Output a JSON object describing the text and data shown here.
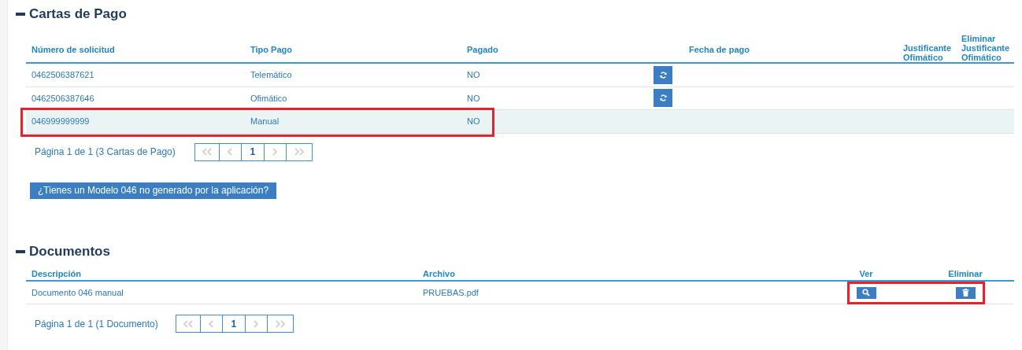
{
  "sections": [
    {
      "kind": "cartas",
      "title": "Cartas de Pago",
      "columns": [
        "Número de solicitud",
        "Tipo Pago",
        "Pagado",
        "",
        "Fecha de pago",
        "Justificante Ofimático",
        "Eliminar Justificante Ofimático"
      ],
      "rows": [
        {
          "cells": [
            "0462506387621",
            "Telemático",
            "NO"
          ],
          "actions": [
            {
              "kind": "refresh"
            }
          ],
          "highlighted": false,
          "outlined": false
        },
        {
          "cells": [
            "0462506387646",
            "Ofimático",
            "NO"
          ],
          "actions": [
            {
              "kind": "refresh"
            }
          ],
          "highlighted": false,
          "outlined": false
        },
        {
          "cells": [
            "046999999999",
            "Manual",
            "NO"
          ],
          "actions": [],
          "highlighted": true,
          "outlined": true
        }
      ],
      "pagination": {
        "summary": "Página 1 de 1 (3 Cartas de Pago)",
        "pages": [
          {
            "label": "1",
            "selected": true
          }
        ]
      },
      "button": "¿Tienes un Modelo 046 no generado por la aplicación?"
    },
    {
      "kind": "documentos",
      "title": "Documentos",
      "columns": [
        "Descripción",
        "Archivo",
        "Ver",
        "Eliminar"
      ],
      "rows": [
        {
          "cells": [
            "Documento 046 manual",
            "PRUEBAS.pdf"
          ],
          "actions": [
            {
              "kind": "view"
            },
            {
              "kind": "delete"
            }
          ],
          "highlighted": false,
          "outlined": true
        }
      ],
      "pagination": {
        "summary": "Página 1 de 1 (1 Documento)",
        "pages": [
          {
            "label": "1",
            "selected": true
          }
        ]
      }
    }
  ]
}
